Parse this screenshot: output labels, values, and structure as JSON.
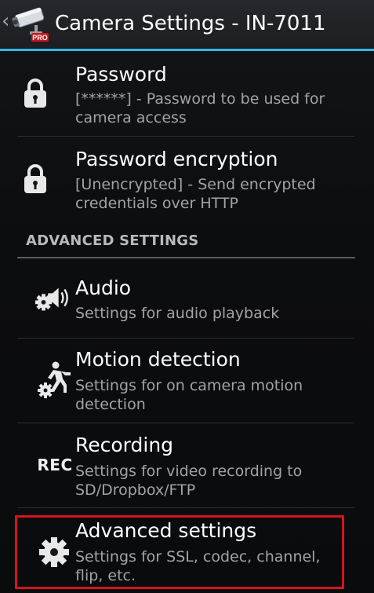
{
  "actionbar": {
    "title": "Camera Settings - IN-7011",
    "up_icon": "chevron-left-icon",
    "app_icon": "security-camera-pro-icon",
    "app_badge": "PRO",
    "accent": "#33b5e5"
  },
  "items": [
    {
      "title": "Password",
      "summary": "[******] - Password to be used for camera access",
      "icon": "lock-icon"
    },
    {
      "title": "Password encryption",
      "summary": "[Unencrypted] - Send encrypted credentials over HTTP",
      "icon": "lock-icon"
    }
  ],
  "section": {
    "label": "ADVANCED SETTINGS"
  },
  "advanced_items": [
    {
      "title": "Audio",
      "summary": "Settings for audio playback",
      "icon": "audio-settings-icon"
    },
    {
      "title": "Motion detection",
      "summary": "Settings for on camera motion detection",
      "icon": "motion-settings-icon"
    },
    {
      "title": "Recording",
      "summary": "Settings for video recording to SD/Dropbox/FTP",
      "icon": "rec-icon",
      "icon_text": "REC"
    },
    {
      "title": "Advanced settings",
      "summary": "Settings for SSL, codec, channel, flip, etc.",
      "icon": "gear-icon"
    }
  ],
  "highlight_color": "#d4141c"
}
